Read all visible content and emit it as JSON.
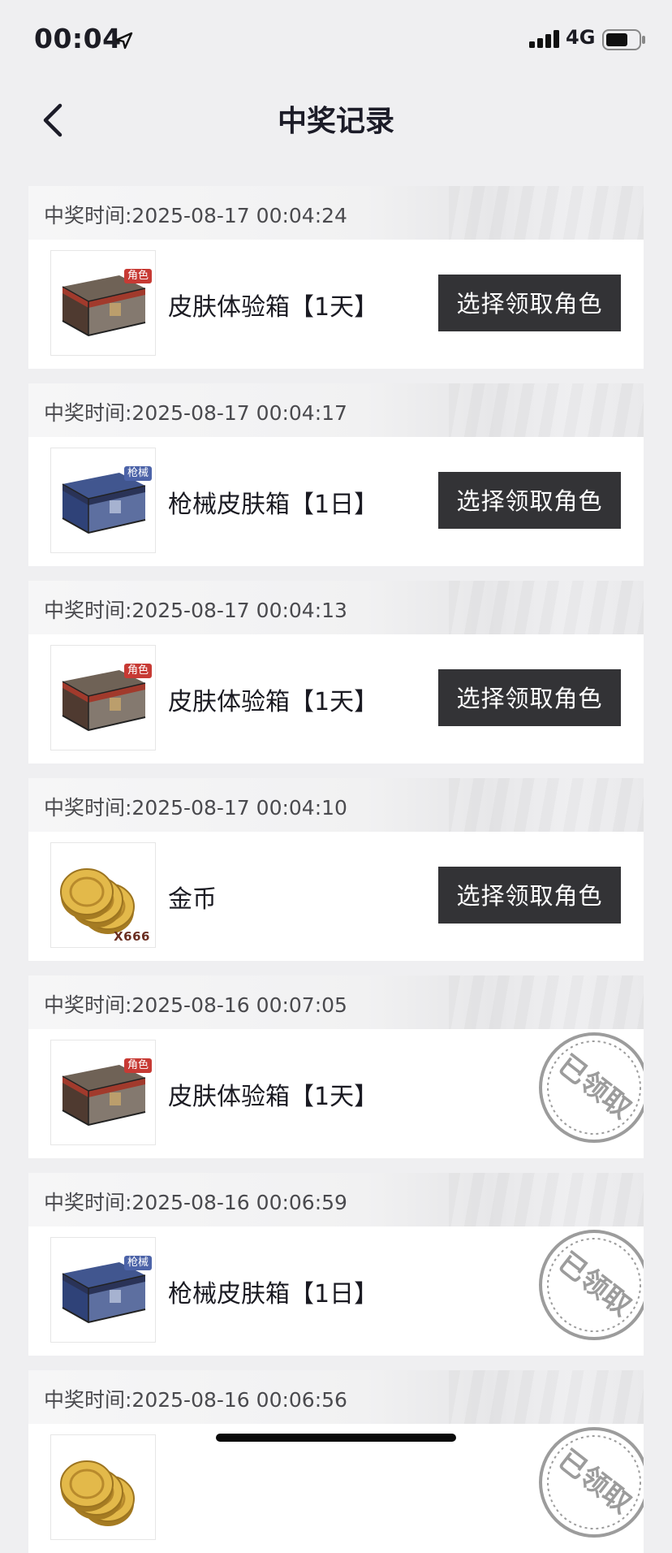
{
  "status_bar": {
    "time": "00:04",
    "network": "4G",
    "icons": [
      "location-arrow-icon",
      "signal-icon",
      "battery-icon"
    ]
  },
  "nav": {
    "title": "中奖记录",
    "back_icon": "chevron-left-icon"
  },
  "colors": {
    "background": "#efeff1",
    "button": "#333336",
    "role_tag": "#c73a34",
    "gun_tag": "#4c63a8"
  },
  "records": [
    {
      "time": "中奖时间:2025-08-17 00:04:24",
      "item": "皮肤体验箱【1天】",
      "image": "skin-chest",
      "tag": "角色",
      "action": "选择领取角色"
    },
    {
      "time": "中奖时间:2025-08-17 00:04:17",
      "item": "枪械皮肤箱【1日】",
      "image": "gun-chest",
      "tag": "枪械",
      "action": "选择领取角色"
    },
    {
      "time": "中奖时间:2025-08-17 00:04:13",
      "item": "皮肤体验箱【1天】",
      "image": "skin-chest",
      "tag": "角色",
      "action": "选择领取角色"
    },
    {
      "time": "中奖时间:2025-08-17 00:04:10",
      "item": "金币",
      "image": "coins",
      "qty": "X666",
      "action": "选择领取角色"
    },
    {
      "time": "中奖时间:2025-08-16 00:07:05",
      "item": "皮肤体验箱【1天】",
      "image": "skin-chest",
      "tag": "角色",
      "stamp": "已领取"
    },
    {
      "time": "中奖时间:2025-08-16 00:06:59",
      "item": "枪械皮肤箱【1日】",
      "image": "gun-chest",
      "tag": "枪械",
      "stamp": "已领取"
    },
    {
      "time": "中奖时间:2025-08-16 00:06:56",
      "image": "coins",
      "stamp": "已领取"
    }
  ]
}
